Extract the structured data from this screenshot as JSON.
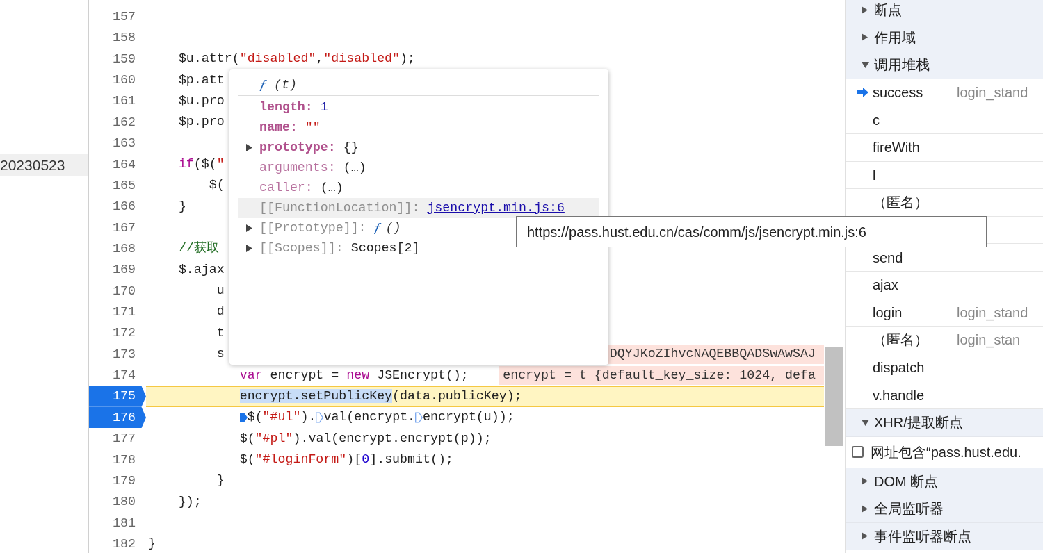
{
  "file_tree": {
    "items": [
      {
        "label": "20230523",
        "selected": true
      }
    ]
  },
  "editor": {
    "lines": [
      {
        "number": "157",
        "breakpoint": false,
        "paused": false
      },
      {
        "number": "158",
        "breakpoint": false,
        "paused": false
      },
      {
        "number": "159",
        "breakpoint": false,
        "paused": false,
        "code": [
          {
            "kind": "plain",
            "text": "    $u.attr("
          },
          {
            "kind": "string",
            "text": "\"disabled\""
          },
          {
            "kind": "plain",
            "text": ","
          },
          {
            "kind": "string",
            "text": "\"disabled\""
          },
          {
            "kind": "plain",
            "text": ");"
          }
        ]
      },
      {
        "number": "160",
        "breakpoint": false,
        "paused": false,
        "code": [
          {
            "kind": "plain",
            "text": "    $p.att"
          }
        ]
      },
      {
        "number": "161",
        "breakpoint": false,
        "paused": false,
        "code": [
          {
            "kind": "plain",
            "text": "    $u.pro"
          }
        ]
      },
      {
        "number": "162",
        "breakpoint": false,
        "paused": false,
        "code": [
          {
            "kind": "plain",
            "text": "    $p.pro"
          }
        ]
      },
      {
        "number": "163",
        "breakpoint": false,
        "paused": false
      },
      {
        "number": "164",
        "breakpoint": false,
        "paused": false,
        "code": [
          {
            "kind": "keyword",
            "text": "    if"
          },
          {
            "kind": "plain",
            "text": "($("
          },
          {
            "kind": "string",
            "text": "\""
          }
        ]
      },
      {
        "number": "165",
        "breakpoint": false,
        "paused": false,
        "code": [
          {
            "kind": "plain",
            "text": "        $("
          }
        ]
      },
      {
        "number": "166",
        "breakpoint": false,
        "paused": false,
        "code": [
          {
            "kind": "plain",
            "text": "    }"
          }
        ]
      },
      {
        "number": "167",
        "breakpoint": false,
        "paused": false
      },
      {
        "number": "168",
        "breakpoint": false,
        "paused": false,
        "code": [
          {
            "kind": "comment",
            "text": "    //获取"
          }
        ]
      },
      {
        "number": "169",
        "breakpoint": false,
        "paused": false,
        "code": [
          {
            "kind": "plain",
            "text": "    $.ajax"
          }
        ]
      },
      {
        "number": "170",
        "breakpoint": false,
        "paused": false,
        "code": [
          {
            "kind": "plain",
            "text": "         u"
          }
        ]
      },
      {
        "number": "171",
        "breakpoint": false,
        "paused": false,
        "code": [
          {
            "kind": "plain",
            "text": "         d"
          }
        ]
      },
      {
        "number": "172",
        "breakpoint": false,
        "paused": false,
        "code": [
          {
            "kind": "plain",
            "text": "         t"
          }
        ]
      },
      {
        "number": "173",
        "breakpoint": false,
        "paused": false,
        "code": [
          {
            "kind": "plain",
            "text": "         s"
          },
          {
            "kind": "hint",
            "text": "DQYJKoZIhvcNAQEBBQADSwAwSAJ"
          }
        ]
      },
      {
        "number": "174",
        "breakpoint": false,
        "paused": false,
        "code": [
          {
            "kind": "keyword",
            "text": "            var"
          },
          {
            "kind": "plain",
            "text": " encrypt = "
          },
          {
            "kind": "keyword",
            "text": "new"
          },
          {
            "kind": "plain",
            "text": " JSEncrypt();"
          },
          {
            "kind": "hint",
            "text": "encrypt = t {default_key_size: 1024, defa"
          }
        ]
      },
      {
        "number": "175",
        "breakpoint": true,
        "paused": true,
        "code": [
          {
            "kind": "selected",
            "text": "            encrypt.setPublicKey"
          },
          {
            "kind": "plain",
            "text": "(data.publicKey);"
          }
        ]
      },
      {
        "number": "176",
        "breakpoint": true,
        "paused": false,
        "code": [
          {
            "kind": "plain",
            "text": "            $(",
            "marker": {
              "active": true
            }
          },
          {
            "kind": "string",
            "text": "\"#ul\""
          },
          {
            "kind": "plain",
            "text": ")."
          },
          {
            "kind": "plain",
            "text": "val(encrypt.",
            "marker": {
              "active": false
            }
          },
          {
            "kind": "plain",
            "text": "encrypt(u));",
            "marker": {
              "active": false
            }
          }
        ]
      },
      {
        "number": "177",
        "breakpoint": false,
        "paused": false,
        "code": [
          {
            "kind": "plain",
            "text": "            $("
          },
          {
            "kind": "string",
            "text": "\"#pl\""
          },
          {
            "kind": "plain",
            "text": ").val(encrypt.encrypt(p));"
          }
        ]
      },
      {
        "number": "178",
        "breakpoint": false,
        "paused": false,
        "code": [
          {
            "kind": "plain",
            "text": "            $("
          },
          {
            "kind": "string",
            "text": "\"#loginForm\""
          },
          {
            "kind": "plain",
            "text": ")["
          },
          {
            "kind": "number",
            "text": "0"
          },
          {
            "kind": "plain",
            "text": "].submit();"
          }
        ]
      },
      {
        "number": "179",
        "breakpoint": false,
        "paused": false,
        "code": [
          {
            "kind": "plain",
            "text": "         }"
          }
        ]
      },
      {
        "number": "180",
        "breakpoint": false,
        "paused": false,
        "code": [
          {
            "kind": "plain",
            "text": "    });"
          }
        ]
      },
      {
        "number": "181",
        "breakpoint": false,
        "paused": false
      },
      {
        "number": "182",
        "breakpoint": false,
        "paused": false,
        "code": [
          {
            "kind": "plain",
            "text": "}"
          }
        ]
      }
    ]
  },
  "popover": {
    "header": {
      "prefix": "ƒ",
      "signature": "(t)"
    },
    "properties": [
      {
        "kind": "own",
        "key": "length:",
        "value": {
          "kind": "number",
          "text": "1"
        },
        "expandable": false,
        "highlighted": false
      },
      {
        "kind": "own",
        "key": "name:",
        "value": {
          "kind": "string",
          "text": "\"\""
        },
        "expandable": false,
        "highlighted": false
      },
      {
        "kind": "own",
        "key": "prototype:",
        "value": {
          "kind": "plain",
          "text": "{}"
        },
        "expandable": true,
        "highlighted": false
      },
      {
        "kind": "accessor",
        "key": "arguments:",
        "value": {
          "kind": "plain",
          "text": "(…)"
        },
        "expandable": false,
        "highlighted": false
      },
      {
        "kind": "accessor",
        "key": "caller:",
        "value": {
          "kind": "plain",
          "text": "(…)"
        },
        "expandable": false,
        "highlighted": false
      },
      {
        "kind": "internal",
        "key": "[[FunctionLocation]]:",
        "value": {
          "kind": "link",
          "text": "jsencrypt.min.js:6"
        },
        "expandable": false,
        "highlighted": true
      },
      {
        "kind": "internal",
        "key": "[[Prototype]]:",
        "value": {
          "kind": "function",
          "text": "ƒ ()"
        },
        "expandable": true,
        "highlighted": false
      },
      {
        "kind": "internal",
        "key": "[[Scopes]]:",
        "value": {
          "kind": "plain",
          "text": "Scopes[2]"
        },
        "expandable": true,
        "highlighted": false
      }
    ]
  },
  "tooltip": {
    "text": "https://pass.hust.edu.cn/cas/comm/js/jsencrypt.min.js:6"
  },
  "debugger_panel": {
    "items": [
      {
        "kind": "section",
        "label": "断点",
        "expanded": false
      },
      {
        "kind": "section",
        "label": "作用域",
        "expanded": false
      },
      {
        "kind": "section",
        "label": "调用堆栈",
        "expanded": true
      },
      {
        "kind": "frame",
        "name": "success",
        "source": "login_stand",
        "selected": true
      },
      {
        "kind": "frame",
        "name": "c",
        "selected": false
      },
      {
        "kind": "frame",
        "name": "fireWith",
        "selected": false
      },
      {
        "kind": "frame",
        "name": "l",
        "selected": false
      },
      {
        "kind": "frame",
        "name": "（匿名）",
        "selected": false
      },
      {
        "kind": "hidden_frame"
      },
      {
        "kind": "frame",
        "name": "send",
        "selected": false
      },
      {
        "kind": "frame",
        "name": "ajax",
        "selected": false
      },
      {
        "kind": "frame",
        "name": "login",
        "source": "login_stand",
        "selected": false
      },
      {
        "kind": "frame",
        "name": "（匿名）",
        "source": "login_stan",
        "selected": false
      },
      {
        "kind": "frame",
        "name": "dispatch",
        "selected": false
      },
      {
        "kind": "frame",
        "name": "v.handle",
        "selected": false
      },
      {
        "kind": "section",
        "label": "XHR/提取断点",
        "expanded": true
      },
      {
        "kind": "checkbox",
        "label": "网址包含“pass.hust.edu.",
        "checked": false
      },
      {
        "kind": "section",
        "label": "DOM 断点",
        "expanded": false
      },
      {
        "kind": "section",
        "label": "全局监听器",
        "expanded": false
      },
      {
        "kind": "section",
        "label": "事件监听器断点",
        "expanded": false
      }
    ]
  }
}
